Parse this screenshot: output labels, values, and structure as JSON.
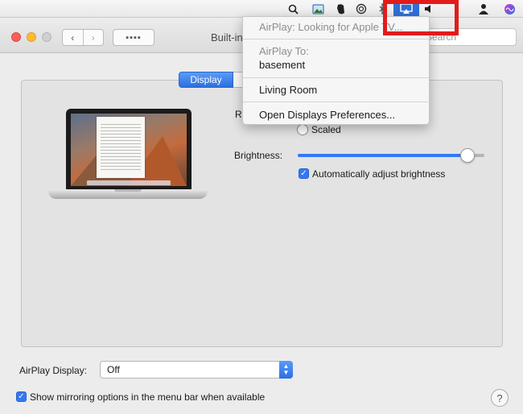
{
  "menubar": {
    "icons": [
      "search-icon",
      "preview-icon",
      "evernote-icon",
      "circle-app-icon",
      "bluetooth-icon",
      "airplay-icon",
      "volume-icon",
      "user-icon",
      "siri-icon"
    ]
  },
  "toolbar": {
    "title": "Built-in",
    "back": "‹",
    "forward": "›",
    "grid": "▪▪▪▪",
    "search_placeholder": "Search"
  },
  "airplay_menu": {
    "status": "AirPlay: Looking for Apple TV...",
    "airplay_to_label": "AirPlay To:",
    "device_basement": "basement",
    "device_living_room": "Living Room",
    "open_prefs": "Open Displays Preferences..."
  },
  "tabs": {
    "display": "Display"
  },
  "display": {
    "resolution_label": "R",
    "scaled_label": "Scaled",
    "brightness_label": "Brightness:",
    "brightness_level": 0.91,
    "auto_brightness_label": "Automatically adjust brightness",
    "auto_brightness_checked": true
  },
  "footer": {
    "airplay_display_label": "AirPlay Display:",
    "airplay_display_value": "Off",
    "mirroring_label": "Show mirroring options in the menu bar when available",
    "mirroring_checked": true,
    "help": "?"
  },
  "colors": {
    "accent": "#3478f6",
    "highlight": "#e21b1b"
  }
}
